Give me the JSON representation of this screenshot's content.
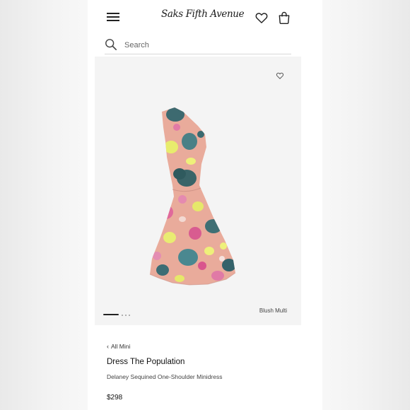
{
  "header": {
    "logo": "Saks Fifth Avenue",
    "menu_icon": "hamburger-menu-icon",
    "wishlist_icon": "heart-icon",
    "bag_icon": "shopping-bag-icon"
  },
  "search": {
    "placeholder": "Search",
    "value": "",
    "icon": "search-icon"
  },
  "product": {
    "image_icon": "dress-image",
    "wishlist_icon": "heart-icon",
    "color_caption": "Blush Multi",
    "carousel": {
      "count": 4,
      "active": 0
    },
    "breadcrumb": "All Mini",
    "brand": "Dress The Population",
    "name": "Delaney Sequined One-Shoulder Minidress",
    "price": "$298"
  },
  "colors": {
    "text": "#222222",
    "image_bg": "#f4f4f4",
    "dress_base": "#e8a99a",
    "sequin_teal": "#3f6f74",
    "sequin_yellow": "#e7ea6b",
    "sequin_pink": "#e06a9c"
  }
}
